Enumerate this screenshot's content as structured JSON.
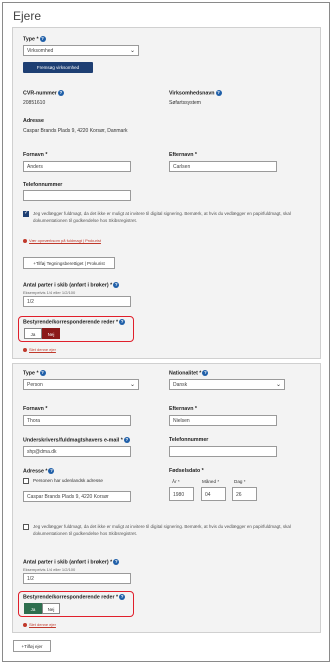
{
  "page": {
    "title": "Ejere"
  },
  "owner1": {
    "type_label": "Type *",
    "type_value": "Virksomhed",
    "fetch_button": "Fremsøg virksomhed",
    "cvr_label": "CVR-nummer",
    "cvr_value": "20851610",
    "company_label": "Virksomhedsnavn",
    "company_value": "Søfartssystem",
    "address_label": "Adresse",
    "address_value": "Caspar Brands Plads 9, 4220 Korsør, Danmark",
    "firstname_label": "Fornavn *",
    "firstname_value": "Anders",
    "lastname_label": "Efternavn *",
    "lastname_value": "Carlsen",
    "phone_label": "Telefonnummer",
    "phone_value": "",
    "consent_text": "Jeg vedlægger fuldmagt, da det ikke er muligt at invitere til digital signering. Bemærk, at hvis du vedlægger en papirfuldmagt, skal dokumentationen til godkendelse hos Skibsregistret.",
    "consent_checked": true,
    "consent_error": "Vær opmærksom på fuldmagt | Prokurist",
    "add_signing_button": "+Tilføj Tegningsberettiget | Prokurist",
    "share_label": "Antal parter i skib (anført i brøker) *",
    "share_hint": "Eksempelvis 1/4 eller 1/2/100",
    "share_value": "1/2",
    "managing_label": "Bestyrende/korresponderende reder *",
    "managing_yes": "Ja",
    "managing_no": "Nej",
    "managing_selected": "Nej",
    "remove_link": "Slet denne ejer"
  },
  "owner2": {
    "type_label": "Type *",
    "type_value": "Person",
    "nationality_label": "Nationalitet *",
    "nationality_value": "Dansk",
    "firstname_label": "Fornavn *",
    "firstname_value": "Thora",
    "lastname_label": "Efternavn *",
    "lastname_value": "Nielsen",
    "email_label": "Underskrivers/fuldmagtshavers e-mail *",
    "email_value": "shp@dma.dk",
    "phone_label": "Telefonnummer",
    "phone_value": "",
    "address_label": "Adresse *",
    "foreign_address_label": "Personen har udenlandsk adresse",
    "address_value": "Caspar Brands Plads 9, 4220 Korsør",
    "birthdate_label": "Fødselsdato *",
    "year_label": "År *",
    "month_label": "Måned *",
    "day_label": "Dag *",
    "year_value": "1980",
    "month_value": "04",
    "day_value": "26",
    "consent_text": "Jeg vedlægger fuldmagt, da det ikke er muligt at invitere til digital signering. Bemærk, at hvis du vedlægger en papirfuldmagt, skal dokumentationen til godkendelse hos Skibsregistret.",
    "consent_checked": false,
    "share_label": "Antal parter i skib (anført i brøker) *",
    "share_hint": "Eksempelvis 1/4 eller 1/2/100",
    "share_value": "1/2",
    "managing_label": "Bestyrende/korresponderende reder *",
    "managing_yes": "Ja",
    "managing_no": "Nej",
    "managing_selected": "Ja",
    "remove_link": "Slet denne ejer"
  },
  "add_owner_button": "+Tilføj ejer",
  "colors": {
    "primary": "#1e3f73",
    "error": "#c0392b",
    "highlight": "#e01f2b",
    "no_selected": "#8b1a1a",
    "yes_selected": "#2d6e4e"
  }
}
